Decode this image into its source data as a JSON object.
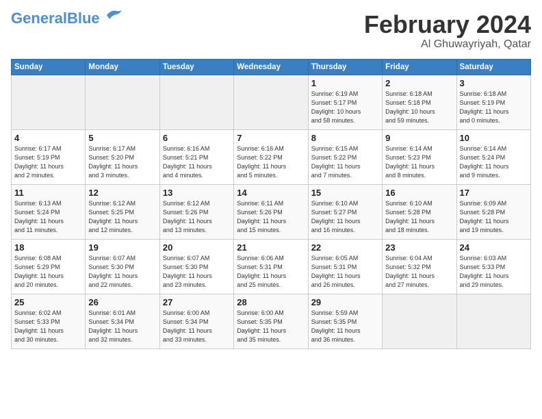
{
  "header": {
    "logo_general": "General",
    "logo_blue": "Blue",
    "month": "February 2024",
    "location": "Al Ghuwayriyah, Qatar"
  },
  "weekdays": [
    "Sunday",
    "Monday",
    "Tuesday",
    "Wednesday",
    "Thursday",
    "Friday",
    "Saturday"
  ],
  "weeks": [
    [
      {
        "day": "",
        "info": ""
      },
      {
        "day": "",
        "info": ""
      },
      {
        "day": "",
        "info": ""
      },
      {
        "day": "",
        "info": ""
      },
      {
        "day": "1",
        "info": "Sunrise: 6:19 AM\nSunset: 5:17 PM\nDaylight: 10 hours\nand 58 minutes."
      },
      {
        "day": "2",
        "info": "Sunrise: 6:18 AM\nSunset: 5:18 PM\nDaylight: 10 hours\nand 59 minutes."
      },
      {
        "day": "3",
        "info": "Sunrise: 6:18 AM\nSunset: 5:19 PM\nDaylight: 11 hours\nand 0 minutes."
      }
    ],
    [
      {
        "day": "4",
        "info": "Sunrise: 6:17 AM\nSunset: 5:19 PM\nDaylight: 11 hours\nand 2 minutes."
      },
      {
        "day": "5",
        "info": "Sunrise: 6:17 AM\nSunset: 5:20 PM\nDaylight: 11 hours\nand 3 minutes."
      },
      {
        "day": "6",
        "info": "Sunrise: 6:16 AM\nSunset: 5:21 PM\nDaylight: 11 hours\nand 4 minutes."
      },
      {
        "day": "7",
        "info": "Sunrise: 6:16 AM\nSunset: 5:22 PM\nDaylight: 11 hours\nand 5 minutes."
      },
      {
        "day": "8",
        "info": "Sunrise: 6:15 AM\nSunset: 5:22 PM\nDaylight: 11 hours\nand 7 minutes."
      },
      {
        "day": "9",
        "info": "Sunrise: 6:14 AM\nSunset: 5:23 PM\nDaylight: 11 hours\nand 8 minutes."
      },
      {
        "day": "10",
        "info": "Sunrise: 6:14 AM\nSunset: 5:24 PM\nDaylight: 11 hours\nand 9 minutes."
      }
    ],
    [
      {
        "day": "11",
        "info": "Sunrise: 6:13 AM\nSunset: 5:24 PM\nDaylight: 11 hours\nand 11 minutes."
      },
      {
        "day": "12",
        "info": "Sunrise: 6:12 AM\nSunset: 5:25 PM\nDaylight: 11 hours\nand 12 minutes."
      },
      {
        "day": "13",
        "info": "Sunrise: 6:12 AM\nSunset: 5:26 PM\nDaylight: 11 hours\nand 13 minutes."
      },
      {
        "day": "14",
        "info": "Sunrise: 6:11 AM\nSunset: 5:26 PM\nDaylight: 11 hours\nand 15 minutes."
      },
      {
        "day": "15",
        "info": "Sunrise: 6:10 AM\nSunset: 5:27 PM\nDaylight: 11 hours\nand 16 minutes."
      },
      {
        "day": "16",
        "info": "Sunrise: 6:10 AM\nSunset: 5:28 PM\nDaylight: 11 hours\nand 18 minutes."
      },
      {
        "day": "17",
        "info": "Sunrise: 6:09 AM\nSunset: 5:28 PM\nDaylight: 11 hours\nand 19 minutes."
      }
    ],
    [
      {
        "day": "18",
        "info": "Sunrise: 6:08 AM\nSunset: 5:29 PM\nDaylight: 11 hours\nand 20 minutes."
      },
      {
        "day": "19",
        "info": "Sunrise: 6:07 AM\nSunset: 5:30 PM\nDaylight: 11 hours\nand 22 minutes."
      },
      {
        "day": "20",
        "info": "Sunrise: 6:07 AM\nSunset: 5:30 PM\nDaylight: 11 hours\nand 23 minutes."
      },
      {
        "day": "21",
        "info": "Sunrise: 6:06 AM\nSunset: 5:31 PM\nDaylight: 11 hours\nand 25 minutes."
      },
      {
        "day": "22",
        "info": "Sunrise: 6:05 AM\nSunset: 5:31 PM\nDaylight: 11 hours\nand 26 minutes."
      },
      {
        "day": "23",
        "info": "Sunrise: 6:04 AM\nSunset: 5:32 PM\nDaylight: 11 hours\nand 27 minutes."
      },
      {
        "day": "24",
        "info": "Sunrise: 6:03 AM\nSunset: 5:33 PM\nDaylight: 11 hours\nand 29 minutes."
      }
    ],
    [
      {
        "day": "25",
        "info": "Sunrise: 6:02 AM\nSunset: 5:33 PM\nDaylight: 11 hours\nand 30 minutes."
      },
      {
        "day": "26",
        "info": "Sunrise: 6:01 AM\nSunset: 5:34 PM\nDaylight: 11 hours\nand 32 minutes."
      },
      {
        "day": "27",
        "info": "Sunrise: 6:00 AM\nSunset: 5:34 PM\nDaylight: 11 hours\nand 33 minutes."
      },
      {
        "day": "28",
        "info": "Sunrise: 6:00 AM\nSunset: 5:35 PM\nDaylight: 11 hours\nand 35 minutes."
      },
      {
        "day": "29",
        "info": "Sunrise: 5:59 AM\nSunset: 5:35 PM\nDaylight: 11 hours\nand 36 minutes."
      },
      {
        "day": "",
        "info": ""
      },
      {
        "day": "",
        "info": ""
      }
    ]
  ]
}
